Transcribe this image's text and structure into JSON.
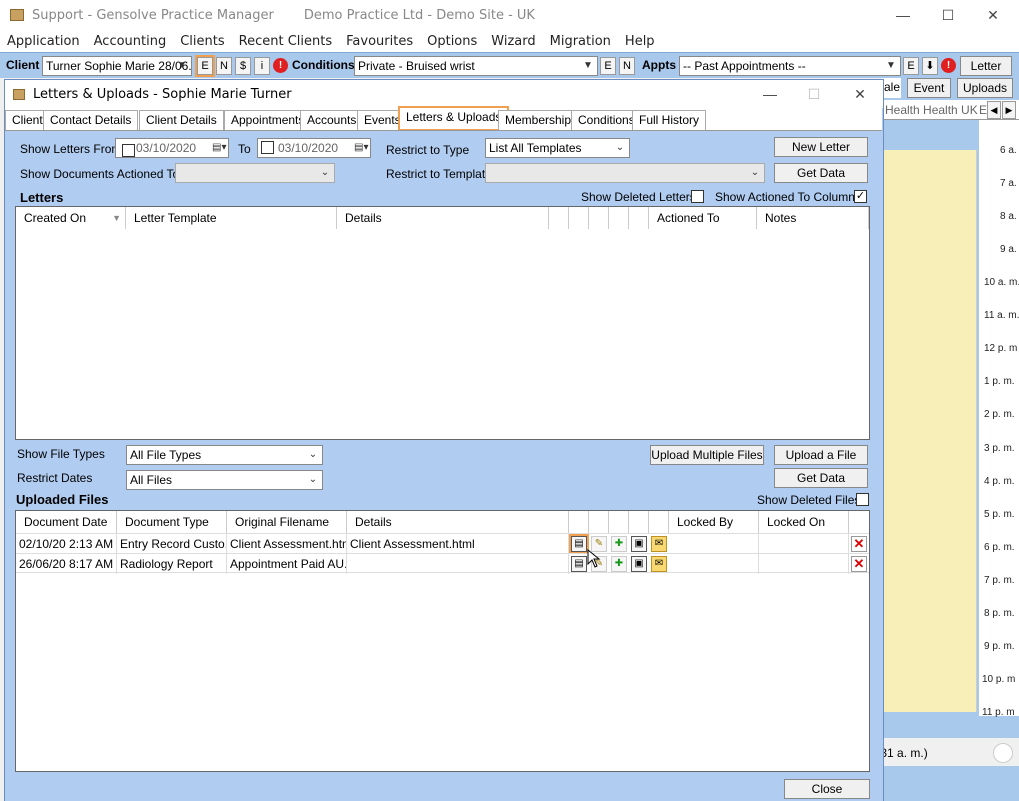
{
  "main_window": {
    "title": "Support - Gensolve Practice Manager",
    "subtitle": "Demo Practice Ltd - Demo Site - UK",
    "min": "—",
    "max": "☐",
    "close": "✕"
  },
  "menu": [
    "Application",
    "Accounting",
    "Clients",
    "Recent Clients",
    "Favourites",
    "Options",
    "Wizard",
    "Migration",
    "Help"
  ],
  "client_bar": {
    "client_label": "Client",
    "client_value": "Turner Sophie Marie 28/06.",
    "btn_e": "E",
    "btn_n": "N",
    "btn_dollar": "$",
    "btn_i": "i",
    "conditions_label": "Conditions",
    "conditions_value": "Private - Bruised wrist",
    "btn_e2": "E",
    "btn_n2": "N",
    "appts_label": "Appts",
    "appts_value": "-- Past Appointments --",
    "btn_e3": "E",
    "letter_btn": "Letter"
  },
  "right_pane": {
    "row2": [
      "ale",
      "Event",
      "Uploads"
    ],
    "tab_label": "Health Health UK",
    "tab_label2": "E",
    "times": [
      "6 a. m.",
      "7 a. m.",
      "8 a. m.",
      "9 a. m.",
      "10 a. m.",
      "11 a. m.",
      "12 p. m",
      "1 p. m.",
      "2 p. m.",
      "3 p. m.",
      "4 p. m.",
      "5 p. m.",
      "6 p. m.",
      "7 p. m.",
      "8 p. m.",
      "9 p. m.",
      "10 p. m",
      "11 p. m"
    ],
    "status": ":31 a. m.)"
  },
  "dialog": {
    "title": "Letters & Uploads - Sophie Marie Turner",
    "tabs": [
      "Client",
      "Contact Details",
      "Client Details",
      "Appointments",
      "Accounts",
      "Events",
      "Letters & Uploads",
      "Memberships",
      "Conditions",
      "Full History"
    ],
    "show_letters_from": "Show Letters From",
    "date_from": "03/10/2020",
    "to_label": "To",
    "date_to": "03/10/2020",
    "restrict_type_label": "Restrict to Type",
    "restrict_type_value": "List All Templates",
    "new_letter": "New Letter",
    "get_data": "Get Data",
    "show_docs_actioned": "Show Documents Actioned To",
    "restrict_template_label": "Restrict to Template",
    "letters_heading": "Letters",
    "show_deleted_letters": "Show Deleted Letters",
    "show_actioned_cols": "Show Actioned To Columns",
    "letters_cols": [
      "Created On",
      "Letter Template",
      "Details",
      "Actioned To",
      "Notes"
    ],
    "show_file_types": "Show File Types",
    "file_types_value": "All File Types",
    "restrict_dates": "Restrict Dates",
    "restrict_dates_value": "All Files",
    "upload_multiple": "Upload Multiple Files",
    "upload_file": "Upload a File",
    "get_data2": "Get Data",
    "uploaded_heading": "Uploaded Files",
    "show_deleted_files": "Show Deleted Files",
    "upload_cols": [
      "Document Date",
      "Document Type",
      "Original Filename",
      "Details",
      "Locked By",
      "Locked On"
    ],
    "rows": [
      {
        "date": "02/10/20 2:13 AM",
        "type": "Entry Record Custo...",
        "filename": "Client Assessment.html",
        "details": "Client Assessment.html"
      },
      {
        "date": "26/06/20 8:17 AM",
        "type": "Radiology Report",
        "filename": "Appointment Paid AU...",
        "details": ""
      }
    ],
    "close": "Close"
  },
  "colors": {
    "accent": "#f0a050",
    "panel": "#b0ccf0",
    "calendar": "#f8efb8"
  }
}
